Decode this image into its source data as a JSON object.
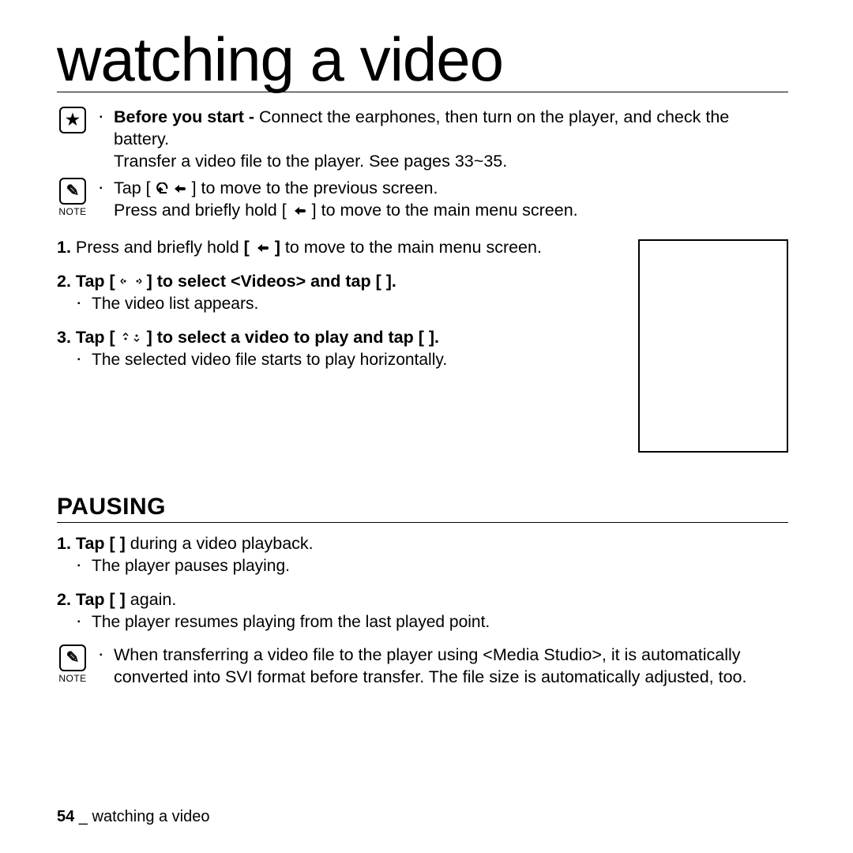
{
  "title": "watching a video",
  "star_block": {
    "line1_prefix": "Before you start - ",
    "line1_rest": "Connect the earphones, then turn on the player, and check the battery.",
    "line2": "Transfer a video file to the player. See pages 33~35."
  },
  "note1": {
    "label": "NOTE",
    "line1_a": "Tap [ ",
    "line1_b": " ] to move to the previous screen.",
    "line2_a": "Press and briefly hold [ ",
    "line2_b": " ] to move to the main menu screen."
  },
  "steps": {
    "s1_a": "1.",
    "s1_b": " Press and briefly hold ",
    "s1_c": " to move to the main menu screen.",
    "s2_a": "2.",
    "s2_b": " Tap ",
    "s2_c": " to select <Videos> and tap [     ].",
    "s2_sub": "The video list appears.",
    "s3_a": "3.",
    "s3_b": " Tap ",
    "s3_c": " to select a video to play and tap [     ].",
    "s3_sub": "The selected video file starts to play horizontally."
  },
  "pausing": {
    "heading": "PAUSING",
    "p1_a": "1.",
    "p1_b": " Tap ",
    "p1_c": "[     ]",
    "p1_d": " during a video playback.",
    "p1_sub": "The player pauses playing.",
    "p2_a": "2.",
    "p2_b": " Tap ",
    "p2_c": "[     ]",
    "p2_d": " again.",
    "p2_sub": "The player resumes playing from the last played point."
  },
  "note2": {
    "label": "NOTE",
    "text": "When transferring a video file to the player using <Media Studio>, it is automatically converted into SVI format before transfer. The file size is automatically adjusted, too."
  },
  "footer": {
    "page": "54",
    "sep": " _ ",
    "section": "watching a video"
  },
  "icons": {
    "star": "★",
    "note_glyph": "✎",
    "bullet": "▪"
  }
}
